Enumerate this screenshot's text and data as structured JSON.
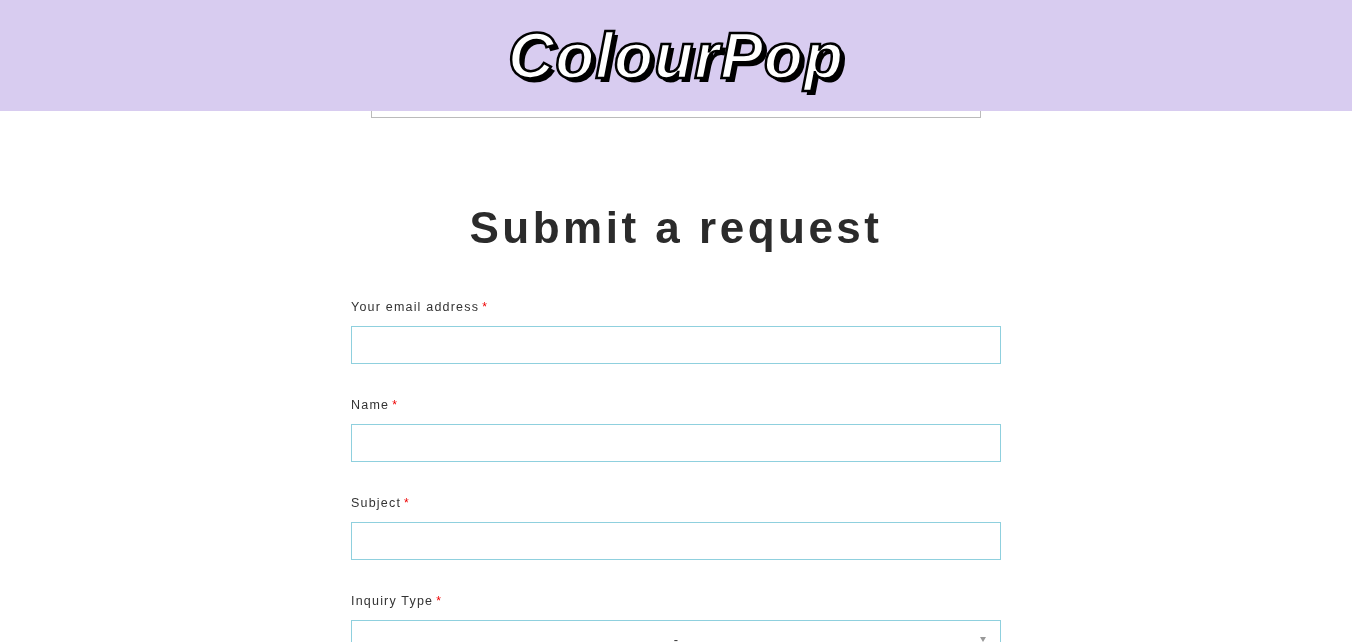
{
  "header": {
    "logo": "ColourPop"
  },
  "title": "Submit a request",
  "fields": [
    {
      "kind": "text",
      "label": "Your email address",
      "marker": "*"
    },
    {
      "kind": "text",
      "label": "Name",
      "marker": "*"
    },
    {
      "kind": "text",
      "label": "Subject",
      "marker": "*"
    },
    {
      "kind": "select",
      "label": "Inquiry Type",
      "marker": "*",
      "value": "-"
    }
  ]
}
